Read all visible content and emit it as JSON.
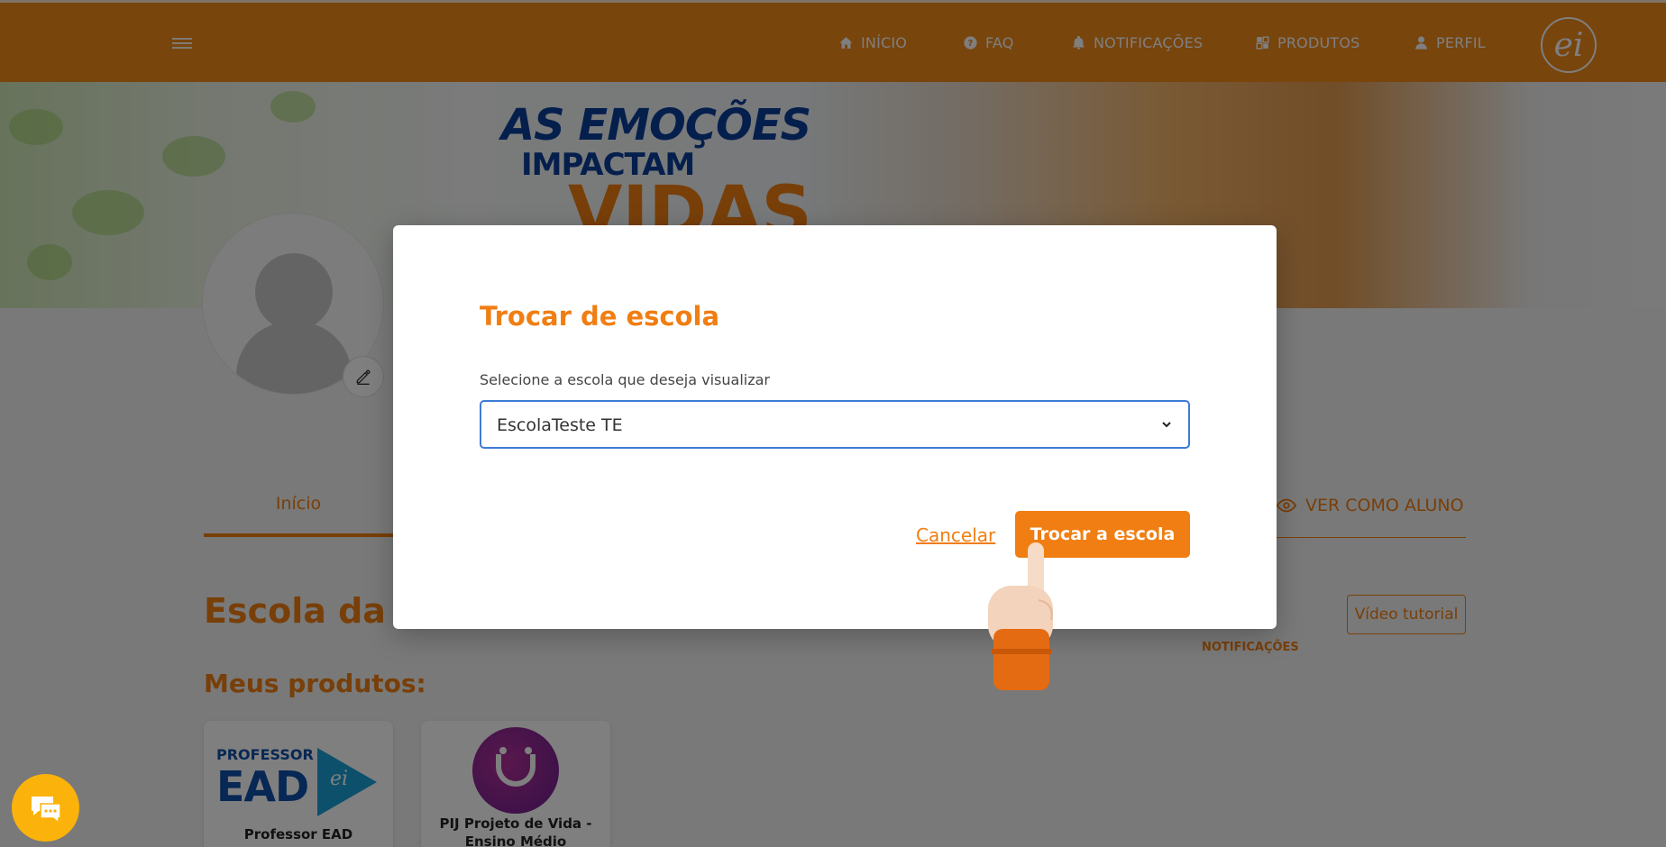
{
  "nav": {
    "home": "INÍCIO",
    "faq": "FAQ",
    "notifications": "NOTIFICAÇÕES",
    "products": "PRODUTOS",
    "profile": "PERFIL",
    "logo": "ei"
  },
  "banner": {
    "line1": "AS EMOÇÕES",
    "line2": "IMPACTAM",
    "line3": "VIDAS"
  },
  "profile": {
    "tab_home": "Início",
    "view_as_student": "VER COMO ALUNO",
    "school_title": "Escola da E",
    "video_tutorial": "Vídeo tutorial",
    "notifications_label": "NOTIFICAÇÕES",
    "my_products": "Meus produtos:"
  },
  "products": [
    {
      "name": "Professor EAD",
      "logo_line1": "PROFESSOR",
      "logo_line2": "EAD",
      "logo_mark": "ei"
    },
    {
      "name": "PIJ Projeto de Vida - Ensino Médio"
    }
  ],
  "modal": {
    "title": "Trocar de escola",
    "label": "Selecione a escola que deseja visualizar",
    "selected": "EscolaTeste TE",
    "cancel": "Cancelar",
    "confirm": "Trocar a escola"
  },
  "colors": {
    "brand_orange": "#f07e12",
    "topbar": "#f18a1a",
    "focus_blue": "#3d7bd6",
    "chat_yellow": "#fbb20b"
  }
}
